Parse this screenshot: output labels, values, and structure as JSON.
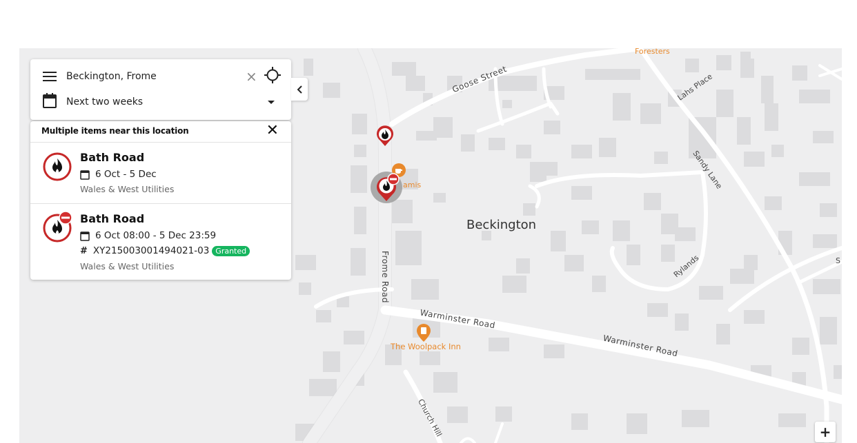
{
  "search": {
    "location": "Beckington, Frome",
    "date_range": "Next two weeks"
  },
  "results": {
    "title": "Multiple items near this location",
    "items": [
      {
        "title": "Bath Road",
        "dates": "6 Oct - 5 Dec",
        "org": "Wales & West Utilities",
        "icon": "gas-fire-icon"
      },
      {
        "title": "Bath Road",
        "dates": "6 Oct 08:00 - 5 Dec 23:59",
        "ref": "XY215003001494021-03",
        "status": "Granted",
        "org": "Wales & West Utilities",
        "icon": "gas-fire-road-closed-icon"
      }
    ]
  },
  "map": {
    "place_label": "Beckington",
    "roads": {
      "goose_street": "Goose Street",
      "lahs_place": "Lahs Place",
      "sandy_lane": "Sandy Lane",
      "frome_road": "Frome Road",
      "warminster_road_1": "Warminster Road",
      "warminster_road_2": "Warminster Road",
      "rylands": "Rylands",
      "church_hill": "Church Hill",
      "edge_s": "S"
    },
    "pois": {
      "foresters": "Foresters",
      "cafe": "amis",
      "pub": "The Woolpack Inn"
    },
    "zoom_in": "+"
  },
  "colors": {
    "marker_red": "#c62828",
    "poi_orange": "#e8892c",
    "granted_green": "#16b55f",
    "map_bg": "#eeeeef"
  }
}
